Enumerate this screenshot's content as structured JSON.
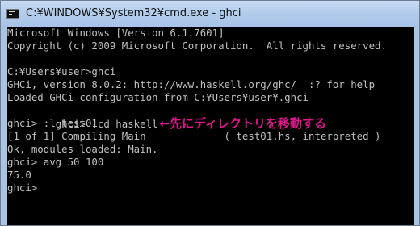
{
  "window": {
    "title": "C:¥WINDOWS¥System32¥cmd.exe - ghci"
  },
  "console": {
    "lines": [
      "Microsoft Windows [Version 6.1.7601]",
      "Copyright (c) 2009 Microsoft Corporation.  All rights reserved.",
      "",
      "C:¥Users¥user>ghci",
      "GHCi, version 8.0.2: http://www.haskell.org/ghc/  :? for help",
      "Loaded GHCi configuration from C:¥Users¥user¥.ghci",
      "ghci> :cd haskell",
      "ghci> :l test01",
      "[1 of 1] Compiling Main             ( test01.hs, interpreted )",
      "Ok, modules loaded: Main.",
      "ghci> avg 50 100",
      "75.0",
      "ghci>"
    ],
    "annotation": "←先にディレクトリを移動する",
    "annotation_color": "#e0158b"
  },
  "icons": {
    "window_icon": "command-prompt-icon"
  }
}
